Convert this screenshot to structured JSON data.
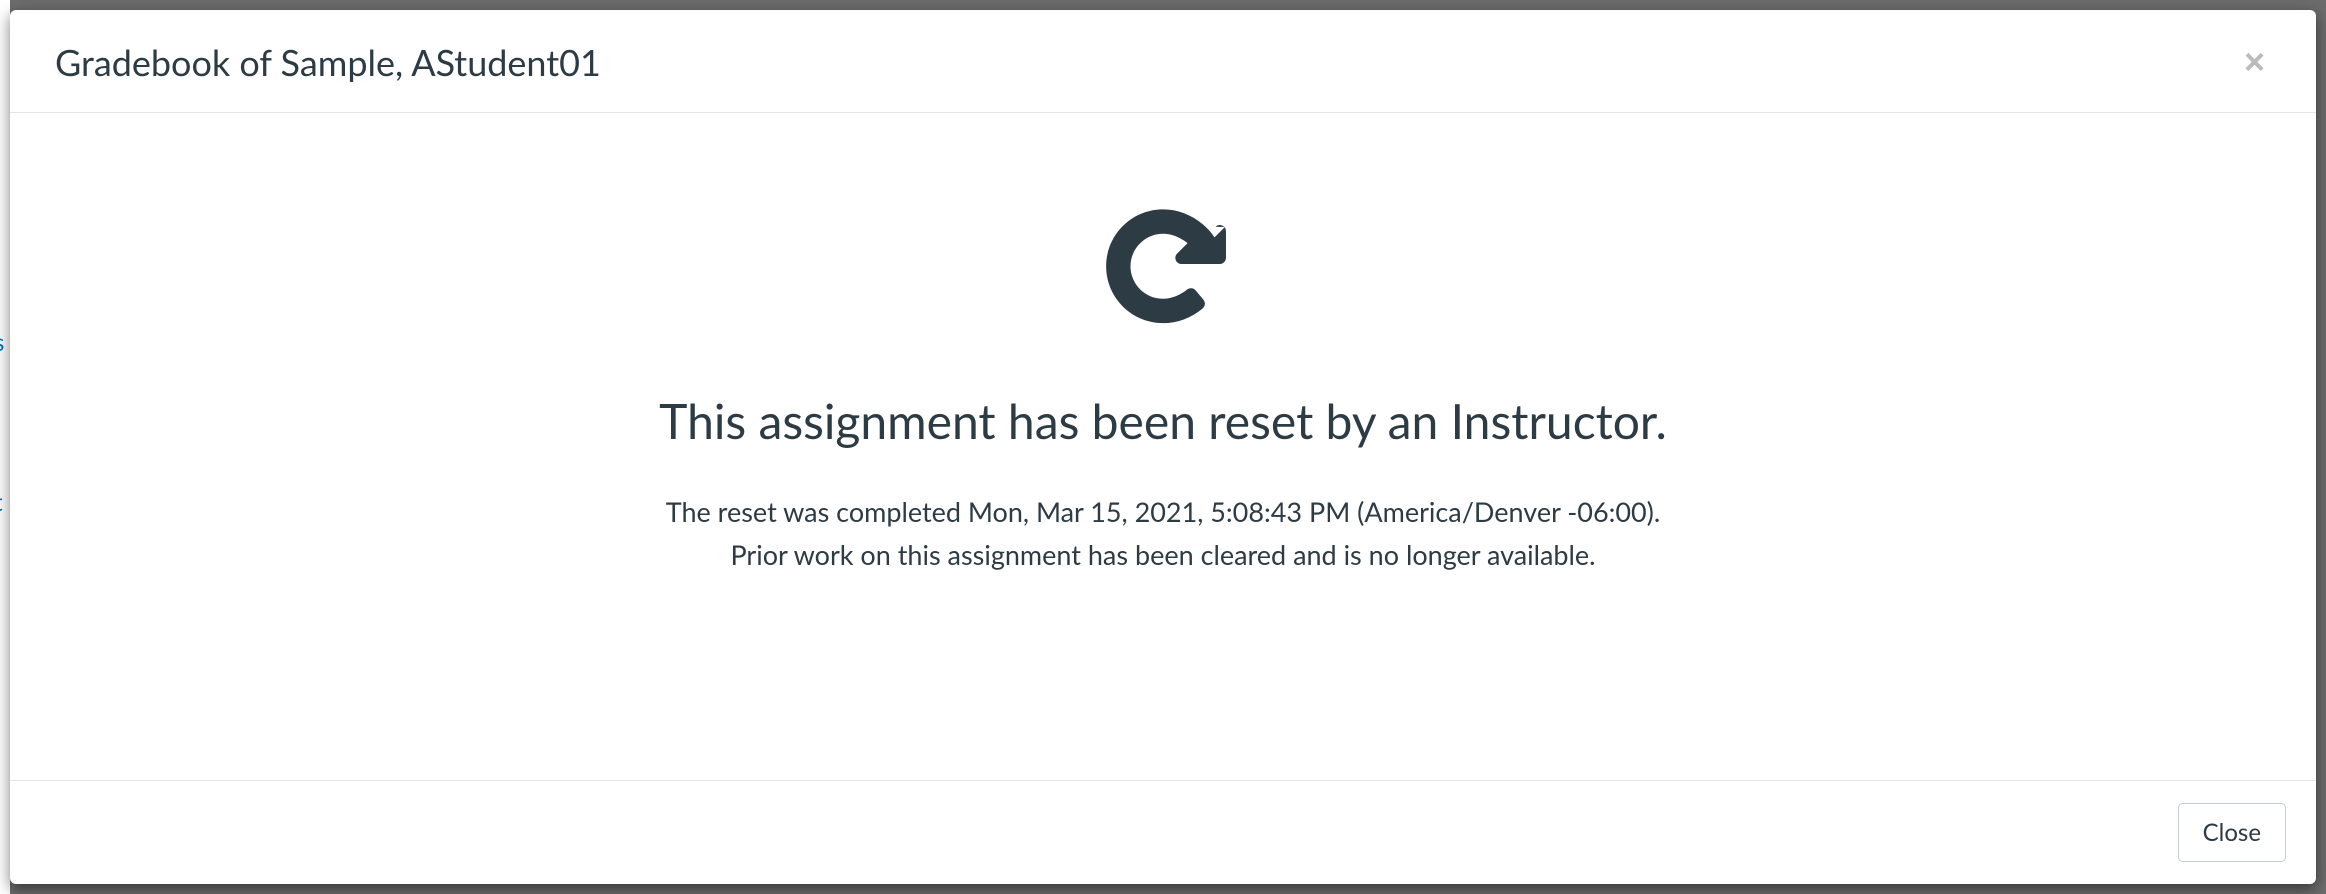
{
  "modal": {
    "title": "Gradebook of Sample, AStudent01",
    "close_x_label": "×",
    "heading": "This assignment has been reset by an Instructor.",
    "line1": "The reset was completed Mon, Mar 15, 2021, 5:08:43 PM (America/Denver -06:00).",
    "line2": "Prior work on this assignment has been cleared and is no longer available.",
    "footer_close_label": "Close"
  },
  "icon_color": "#2d3b45"
}
